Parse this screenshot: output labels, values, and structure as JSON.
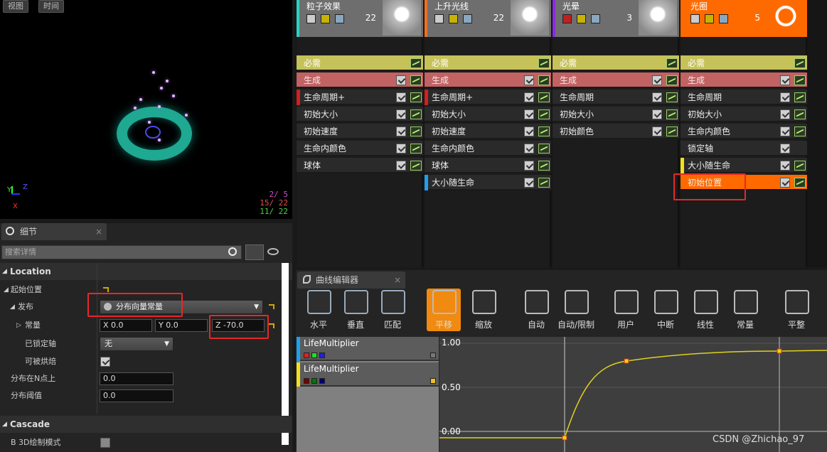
{
  "viewport": {
    "btn_view": "视图",
    "btn_time": "时间",
    "axis_z": "Z",
    "axis_x": "X",
    "counts": [
      "2/ 5",
      "15/ 22",
      "11/ 22"
    ],
    "count_colors": [
      "#d14bd1",
      "#e05050",
      "#4bd14b"
    ]
  },
  "details": {
    "tab": "细节",
    "search_placeholder": "搜索详情",
    "section_location": "Location",
    "start_location": "起始位置",
    "distribution": "发布",
    "distribution_value": "分布向量常量",
    "constant": "常量",
    "x": "X  0.0",
    "y": "Y  0.0",
    "z": "Z  -70.0",
    "locked_axis": "已锁定轴",
    "locked_axis_value": "无",
    "can_bake": "可被烘焙",
    "distribute_n": "分布在N点上",
    "distribute_n_value": "0.0",
    "distribute_threshold": "分布阈值",
    "distribute_threshold_value": "0.0",
    "section_cascade": "Cascade",
    "draw_3d": "B 3D绘制模式"
  },
  "emitters": [
    {
      "name": "粒子效果",
      "count": "22",
      "color": "#2ecfc2",
      "modules": [
        {
          "label": "必需",
          "bg": "#c6c25a"
        },
        {
          "label": "生成",
          "bg": "#c26262"
        },
        {
          "label": "生命周期+",
          "bg": "#2a2a2a",
          "accent": "#d02020"
        },
        {
          "label": "初始大小",
          "bg": "#2a2a2a"
        },
        {
          "label": "初始速度",
          "bg": "#2a2a2a"
        },
        {
          "label": "生命内颜色",
          "bg": "#2a2a2a"
        },
        {
          "label": "球体",
          "bg": "#2a2a2a"
        }
      ]
    },
    {
      "name": "上升光线",
      "count": "22",
      "color": "#f07020",
      "modules": [
        {
          "label": "必需",
          "bg": "#c6c25a"
        },
        {
          "label": "生成",
          "bg": "#c26262"
        },
        {
          "label": "生命周期+",
          "bg": "#2a2a2a",
          "accent": "#d02020"
        },
        {
          "label": "初始大小",
          "bg": "#2a2a2a"
        },
        {
          "label": "初始速度",
          "bg": "#2a2a2a"
        },
        {
          "label": "生命内颜色",
          "bg": "#2a2a2a"
        },
        {
          "label": "球体",
          "bg": "#2a2a2a"
        },
        {
          "label": "大小随生命",
          "bg": "#2a2a2a",
          "accent": "#1e9ff0"
        }
      ]
    },
    {
      "name": "光晕",
      "count": "3",
      "color": "#8a2be2",
      "modules": [
        {
          "label": "必需",
          "bg": "#c6c25a"
        },
        {
          "label": "生成",
          "bg": "#c26262"
        },
        {
          "label": "生命周期",
          "bg": "#2a2a2a"
        },
        {
          "label": "初始大小",
          "bg": "#2a2a2a"
        },
        {
          "label": "初始颜色",
          "bg": "#2a2a2a"
        }
      ]
    },
    {
      "name": "光圈",
      "count": "5",
      "color": "#ff6a00",
      "modules": [
        {
          "label": "必需",
          "bg": "#c6c25a"
        },
        {
          "label": "生成",
          "bg": "#c26262"
        },
        {
          "label": "生命周期",
          "bg": "#2a2a2a"
        },
        {
          "label": "初始大小",
          "bg": "#2a2a2a"
        },
        {
          "label": "生命内颜色",
          "bg": "#2a2a2a"
        },
        {
          "label": "锁定轴",
          "bg": "#2a2a2a"
        },
        {
          "label": "大小随生命",
          "bg": "#2a2a2a",
          "accent": "#f0e020"
        },
        {
          "label": "初始位置",
          "bg": "#ff6a00"
        }
      ]
    }
  ],
  "curve_editor": {
    "tab": "曲线编辑器",
    "tools": [
      "水平",
      "垂直",
      "匹配",
      "平移",
      "缩放",
      "自动",
      "自动/限制",
      "用户",
      "中断",
      "线性",
      "常量",
      "平整"
    ],
    "tracks": [
      {
        "name": "LifeMultiplier",
        "accent": "#1e9ff0"
      },
      {
        "name": "LifeMultiplier",
        "accent": "#f0e020"
      }
    ],
    "axis": [
      "1.00",
      "0.50",
      "0.00"
    ]
  },
  "watermark": "CSDN @Zhichao_97"
}
